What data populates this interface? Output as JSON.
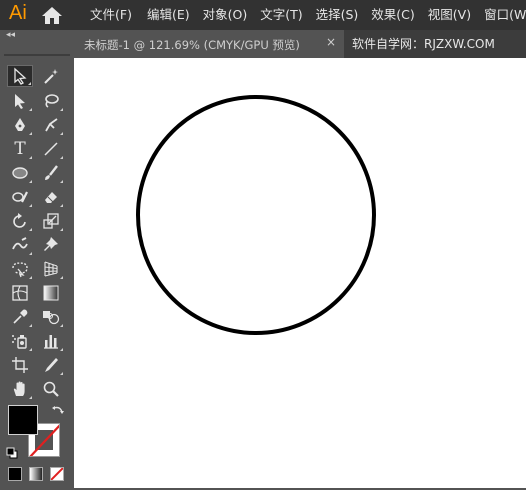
{
  "app": {
    "logo": "Ai"
  },
  "menubar": {
    "items": [
      "文件(F)",
      "编辑(E)",
      "对象(O)",
      "文字(T)",
      "选择(S)",
      "效果(C)",
      "视图(V)",
      "窗口(W)"
    ]
  },
  "document": {
    "tab_title": "未标题-1 @ 121.69% (CMYK/GPU 预览)",
    "close_label": "×"
  },
  "watermark": "软件自学网：RJZXW.COM",
  "toolbar": {
    "collapse_label": "◂◂",
    "tools": [
      {
        "name": "selection-tool",
        "icon": "arrow-outline-icon",
        "selected": true
      },
      {
        "name": "magic-wand-tool",
        "icon": "magic-wand-icon"
      },
      {
        "name": "direct-selection-tool",
        "icon": "arrow-solid-icon"
      },
      {
        "name": "lasso-tool",
        "icon": "lasso-icon"
      },
      {
        "name": "pen-tool",
        "icon": "pen-icon"
      },
      {
        "name": "curvature-tool",
        "icon": "curvature-icon"
      },
      {
        "name": "type-tool",
        "icon": "type-icon",
        "label": "T"
      },
      {
        "name": "line-tool",
        "icon": "line-icon"
      },
      {
        "name": "ellipse-tool",
        "icon": "ellipse-icon"
      },
      {
        "name": "paintbrush-tool",
        "icon": "paintbrush-icon"
      },
      {
        "name": "shaper-tool",
        "icon": "shaper-icon"
      },
      {
        "name": "eraser-tool",
        "icon": "eraser-icon"
      },
      {
        "name": "rotate-tool",
        "icon": "rotate-icon"
      },
      {
        "name": "scale-tool",
        "icon": "scale-icon"
      },
      {
        "name": "warp-tool",
        "icon": "warp-icon"
      },
      {
        "name": "puppet-warp-tool",
        "icon": "pin-icon"
      },
      {
        "name": "free-transform-tool",
        "icon": "free-transform-icon"
      },
      {
        "name": "perspective-grid-tool",
        "icon": "perspective-grid-icon"
      },
      {
        "name": "mesh-tool",
        "icon": "mesh-icon"
      },
      {
        "name": "gradient-tool",
        "icon": "gradient-icon"
      },
      {
        "name": "eyedropper-tool",
        "icon": "eyedropper-icon"
      },
      {
        "name": "blend-tool",
        "icon": "blend-icon"
      },
      {
        "name": "symbol-sprayer-tool",
        "icon": "symbol-sprayer-icon"
      },
      {
        "name": "column-graph-tool",
        "icon": "column-graph-icon"
      },
      {
        "name": "artboard-tool",
        "icon": "artboard-icon"
      },
      {
        "name": "slice-tool",
        "icon": "slice-icon"
      },
      {
        "name": "hand-tool",
        "icon": "hand-icon"
      },
      {
        "name": "zoom-tool",
        "icon": "zoom-icon"
      }
    ]
  },
  "colors": {
    "fill": "#000000",
    "stroke": "none",
    "accent": "#ff9a00",
    "none_slash": "#e02020"
  },
  "canvas": {
    "shape": "ellipse-icon",
    "shape_fill": "#ffffff",
    "shape_stroke": "#000000"
  }
}
